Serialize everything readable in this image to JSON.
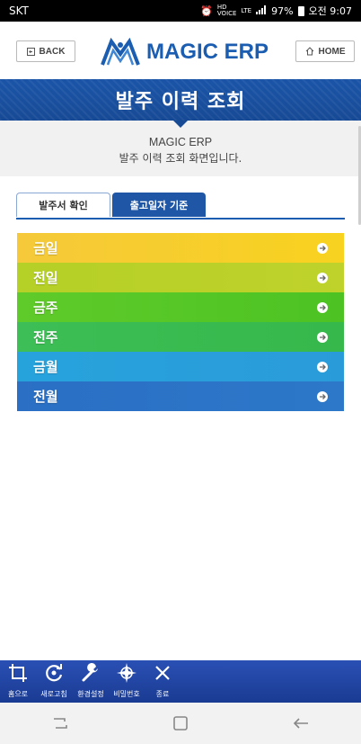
{
  "status_bar": {
    "carrier": "SKT",
    "hd_label": "HD",
    "voice_label": "VOICE",
    "lte_label": "LTE",
    "battery": "97%",
    "time": "오전 9:07"
  },
  "header": {
    "back_label": "BACK",
    "home_label": "HOME",
    "logo_text": "MAGIC ERP"
  },
  "title": "발주 이력 조회",
  "description": {
    "line1": "MAGIC ERP",
    "line2": "발주 이력 조회 화면입니다."
  },
  "tabs": [
    {
      "label": "발주서 확인",
      "active": false
    },
    {
      "label": "출고일자 기준",
      "active": true
    }
  ],
  "menu": [
    {
      "label": "금일",
      "color_from": "#f5c93a",
      "color_to": "#f8d21f"
    },
    {
      "label": "전일",
      "color_from": "#b5d027",
      "color_to": "#bfd22c"
    },
    {
      "label": "금주",
      "color_from": "#5fcb2a",
      "color_to": "#4cc323"
    },
    {
      "label": "전주",
      "color_from": "#3dbe56",
      "color_to": "#36b84b"
    },
    {
      "label": "금월",
      "color_from": "#27a3dc",
      "color_to": "#2a9bd9"
    },
    {
      "label": "전월",
      "color_from": "#2a6fc4",
      "color_to": "#2d78c9"
    }
  ],
  "toolbar": {
    "items": [
      {
        "label": "홈으로",
        "icon": "crop-icon"
      },
      {
        "label": "새로고침",
        "icon": "refresh-icon"
      },
      {
        "label": "환경설정",
        "icon": "wrench-icon"
      },
      {
        "label": "비밀번호",
        "icon": "compass-star-icon"
      },
      {
        "label": "종료",
        "icon": "close-icon"
      }
    ]
  }
}
